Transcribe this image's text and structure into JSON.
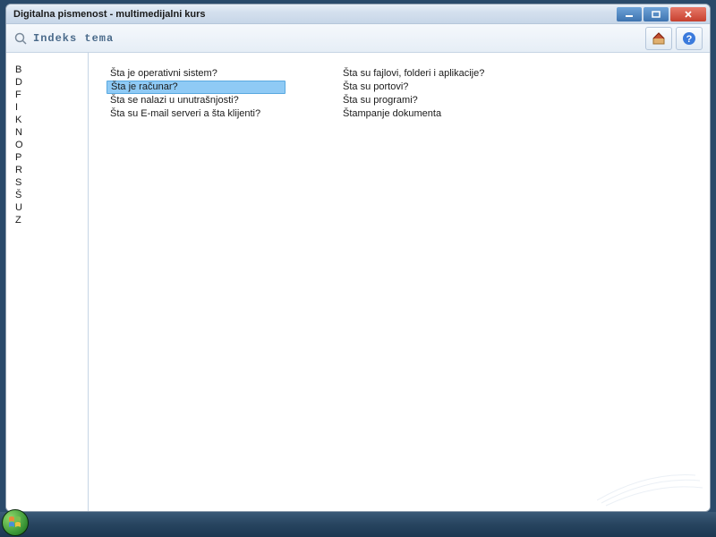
{
  "window": {
    "title": "Digitalna pismenost - multimedijalni kurs"
  },
  "toolbar": {
    "search_label": "Indeks tema"
  },
  "sidebar": {
    "letters": [
      "B",
      "D",
      "F",
      "I",
      "K",
      "N",
      "O",
      "P",
      "R",
      "S",
      "Š",
      "U",
      "Z"
    ]
  },
  "topics": {
    "col1": [
      {
        "label": "Šta je operativni sistem?",
        "selected": false
      },
      {
        "label": "Šta je računar?",
        "selected": true
      },
      {
        "label": "Šta se nalazi u unutrašnjosti?",
        "selected": false
      },
      {
        "label": "Šta su E-mail serveri a šta klijenti?",
        "selected": false
      }
    ],
    "col2": [
      {
        "label": "Šta su fajlovi, folderi i aplikacije?",
        "selected": false
      },
      {
        "label": "Šta su portovi?",
        "selected": false
      },
      {
        "label": "Šta su programi?",
        "selected": false
      },
      {
        "label": "Štampanje dokumenta",
        "selected": false
      }
    ]
  }
}
